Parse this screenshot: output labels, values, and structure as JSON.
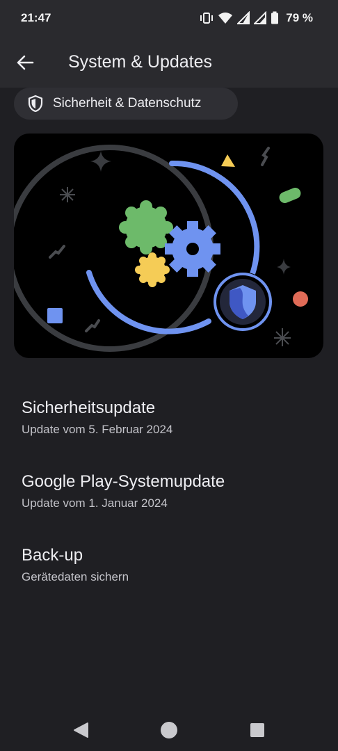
{
  "status_bar": {
    "time": "21:47",
    "battery": "79 %",
    "icons": [
      "vibrate-icon",
      "wifi-icon",
      "signal-icon",
      "signal-icon",
      "battery-icon"
    ]
  },
  "app_bar": {
    "title": "System & Updates",
    "back_icon": "arrow-back-icon"
  },
  "chip": {
    "icon": "shield-icon",
    "label": "Sicherheit & Datenschutz"
  },
  "colors": {
    "background": "#1f1f23",
    "app_bar": "#2a2a2e",
    "blue": "#6f93f0",
    "green": "#6dba6a",
    "yellow": "#f5cc56",
    "red": "#e06b57"
  },
  "settings": [
    {
      "title": "Sicherheitsupdate",
      "subtitle": "Update vom 5. Februar 2024"
    },
    {
      "title": "Google Play-Systemupdate",
      "subtitle": "Update vom 1. Januar 2024"
    },
    {
      "title": "Back-up",
      "subtitle": "Gerätedaten sichern"
    }
  ],
  "nav": {
    "back": "back-triangle-icon",
    "home": "home-circle-icon",
    "recents": "recents-square-icon"
  }
}
